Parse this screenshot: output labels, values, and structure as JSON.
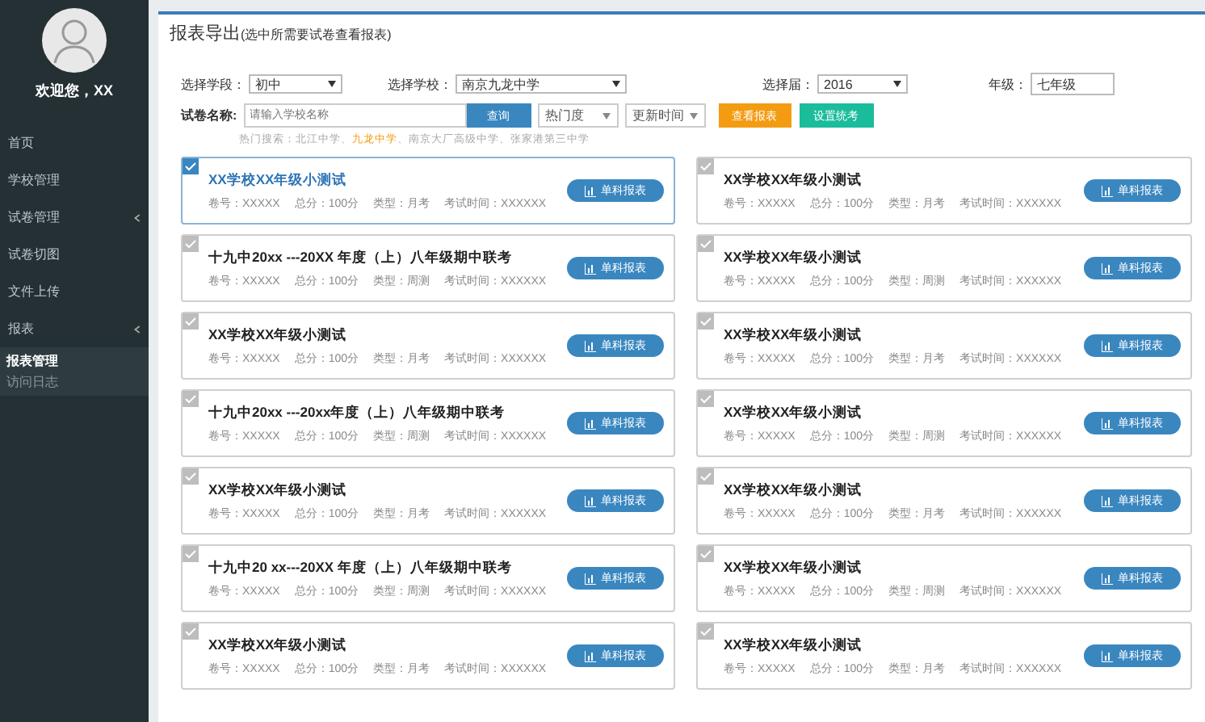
{
  "sidebar": {
    "greeting": "欢迎您，XX",
    "items": [
      {
        "label": "首页",
        "collapsible": false,
        "selected": false
      },
      {
        "label": "学校管理",
        "collapsible": false,
        "selected": false
      },
      {
        "label": "试卷管理",
        "collapsible": true,
        "selected": false
      },
      {
        "label": "试卷切图",
        "collapsible": false,
        "selected": false
      },
      {
        "label": "文件上传",
        "collapsible": false,
        "selected": false
      },
      {
        "label": "报表",
        "collapsible": true,
        "selected": false,
        "children": [
          {
            "label": "报表管理",
            "selected": true
          },
          {
            "label": "访问日志",
            "selected": false
          }
        ]
      }
    ]
  },
  "page": {
    "title": "报表导出",
    "subtitle": "(选中所需要试卷查看报表)"
  },
  "filters": [
    {
      "label": "选择学段：",
      "value": "初中",
      "kind": "select"
    },
    {
      "label": "选择学校：",
      "value": "南京九龙中学",
      "kind": "select"
    },
    {
      "label": "选择届：",
      "value": "2016",
      "kind": "select"
    },
    {
      "label": "年级：",
      "value": "七年级",
      "kind": "input"
    }
  ],
  "search": {
    "label": "试卷名称:",
    "placeholder": "请输入学校名称",
    "button": "查询",
    "sort_options": [
      "热门度",
      "更新时间"
    ],
    "view_button": "查看报表",
    "exam_button": "设置统考",
    "hot_label": "热门搜索：",
    "hot": [
      {
        "text": "北江中学、",
        "highlighted": false
      },
      {
        "text": "九龙中学",
        "highlighted": true
      },
      {
        "text": "、南京大厂高级中学、张家港第三中学",
        "highlighted": false
      }
    ]
  },
  "papers": [
    {
      "title": "XX学校XX年级小测试",
      "selected": true,
      "meta": [
        "卷号：XXXXX",
        "总分：100分",
        "类型：月考",
        "考试时间：XXXXXX"
      ],
      "button": "单科报表"
    },
    {
      "title": "XX学校XX年级小测试",
      "selected": false,
      "meta": [
        "卷号：XXXXX",
        "总分：100分",
        "类型：月考",
        "考试时间：XXXXXX"
      ],
      "button": "单科报表"
    },
    {
      "title": "十九中20xx ---20XX 年度（上）八年级期中联考",
      "selected": false,
      "meta": [
        "卷号：XXXXX",
        "总分：100分",
        "类型：周测",
        "考试时间：XXXXXX"
      ],
      "button": "单科报表"
    },
    {
      "title": "XX学校XX年级小测试",
      "selected": false,
      "meta": [
        "卷号：XXXXX",
        "总分：100分",
        "类型：周测",
        "考试时间：XXXXXX"
      ],
      "button": "单科报表"
    },
    {
      "title": "XX学校XX年级小测试",
      "selected": false,
      "meta": [
        "卷号：XXXXX",
        "总分：100分",
        "类型：月考",
        "考试时间：XXXXXX"
      ],
      "button": "单科报表"
    },
    {
      "title": "XX学校XX年级小测试",
      "selected": false,
      "meta": [
        "卷号：XXXXX",
        "总分：100分",
        "类型：月考",
        "考试时间：XXXXXX"
      ],
      "button": "单科报表"
    },
    {
      "title": "十九中20xx ---20xx年度（上）八年级期中联考",
      "selected": false,
      "meta": [
        "卷号：XXXXX",
        "总分：100分",
        "类型：周测",
        "考试时间：XXXXXX"
      ],
      "button": "单科报表"
    },
    {
      "title": "XX学校XX年级小测试",
      "selected": false,
      "meta": [
        "卷号：XXXXX",
        "总分：100分",
        "类型：周测",
        "考试时间：XXXXXX"
      ],
      "button": "单科报表"
    },
    {
      "title": "XX学校XX年级小测试",
      "selected": false,
      "meta": [
        "卷号：XXXXX",
        "总分：100分",
        "类型：月考",
        "考试时间：XXXXXX"
      ],
      "button": "单科报表"
    },
    {
      "title": "XX学校XX年级小测试",
      "selected": false,
      "meta": [
        "卷号：XXXXX",
        "总分：100分",
        "类型：月考",
        "考试时间：XXXXXX"
      ],
      "button": "单科报表"
    },
    {
      "title": "十九中20 xx---20XX 年度（上）八年级期中联考",
      "selected": false,
      "meta": [
        "卷号：XXXXX",
        "总分：100分",
        "类型：周测",
        "考试时间：XXXXXX"
      ],
      "button": "单科报表"
    },
    {
      "title": "XX学校XX年级小测试",
      "selected": false,
      "meta": [
        "卷号：XXXXX",
        "总分：100分",
        "类型：周测",
        "考试时间：XXXXXX"
      ],
      "button": "单科报表"
    },
    {
      "title": "XX学校XX年级小测试",
      "selected": false,
      "meta": [
        "卷号：XXXXX",
        "总分：100分",
        "类型：月考",
        "考试时间：XXXXXX"
      ],
      "button": "单科报表"
    },
    {
      "title": "XX学校XX年级小测试",
      "selected": false,
      "meta": [
        "卷号：XXXXX",
        "总分：100分",
        "类型：月考",
        "考试时间：XXXXXX"
      ],
      "button": "单科报表"
    }
  ]
}
